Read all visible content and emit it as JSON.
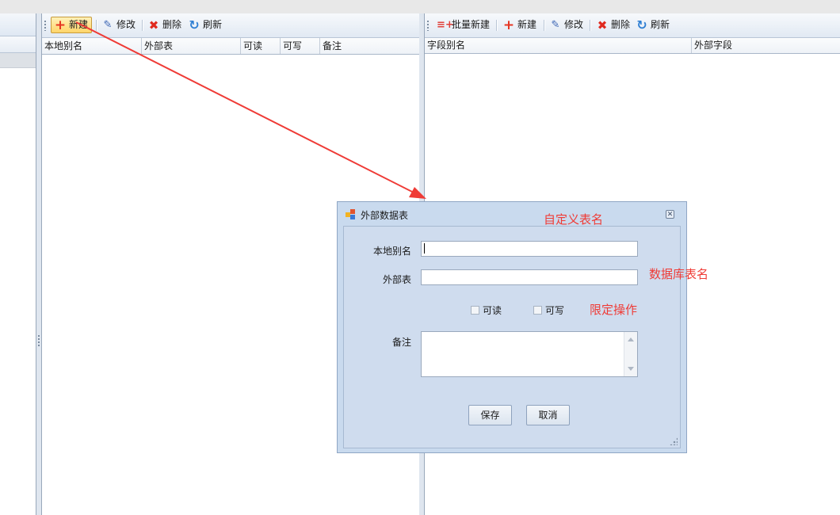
{
  "left_panel": {
    "toolbar": {
      "new": "新建",
      "edit": "修改",
      "delete": "删除",
      "refresh": "刷新",
      "icons": [
        "plus-icon",
        "edit-pencil-icon",
        "delete-x-icon",
        "refresh-icon"
      ]
    },
    "columns": [
      "本地别名",
      "外部表",
      "可读",
      "可写",
      "备注"
    ]
  },
  "right_panel": {
    "toolbar": {
      "batch_new": "批量新建",
      "new": "新建",
      "edit": "修改",
      "delete": "删除",
      "refresh": "刷新"
    },
    "columns": [
      "字段别名",
      "外部字段"
    ]
  },
  "dialog": {
    "title": "外部数据表",
    "fields": {
      "local_alias_label": "本地别名",
      "local_alias_value": "",
      "external_table_label": "外部表",
      "external_table_value": "",
      "readable_label": "可读",
      "readable_checked": false,
      "writable_label": "可写",
      "writable_checked": false,
      "remark_label": "备注",
      "remark_value": ""
    },
    "buttons": {
      "save": "保存",
      "cancel": "取消"
    }
  },
  "annotations": {
    "custom_table_name": "自定义表名",
    "database_table_name": "数据库表名",
    "limit_operation": "限定操作",
    "color": "#ef3b36"
  },
  "colors": {
    "toolbar_gradient_top": "#f7f9fc",
    "toolbar_gradient_bottom": "#e1e9f3",
    "dialog_background": "#c9daee",
    "highlight_button": "#ffd56a",
    "arrow_color": "#ef3b36"
  }
}
